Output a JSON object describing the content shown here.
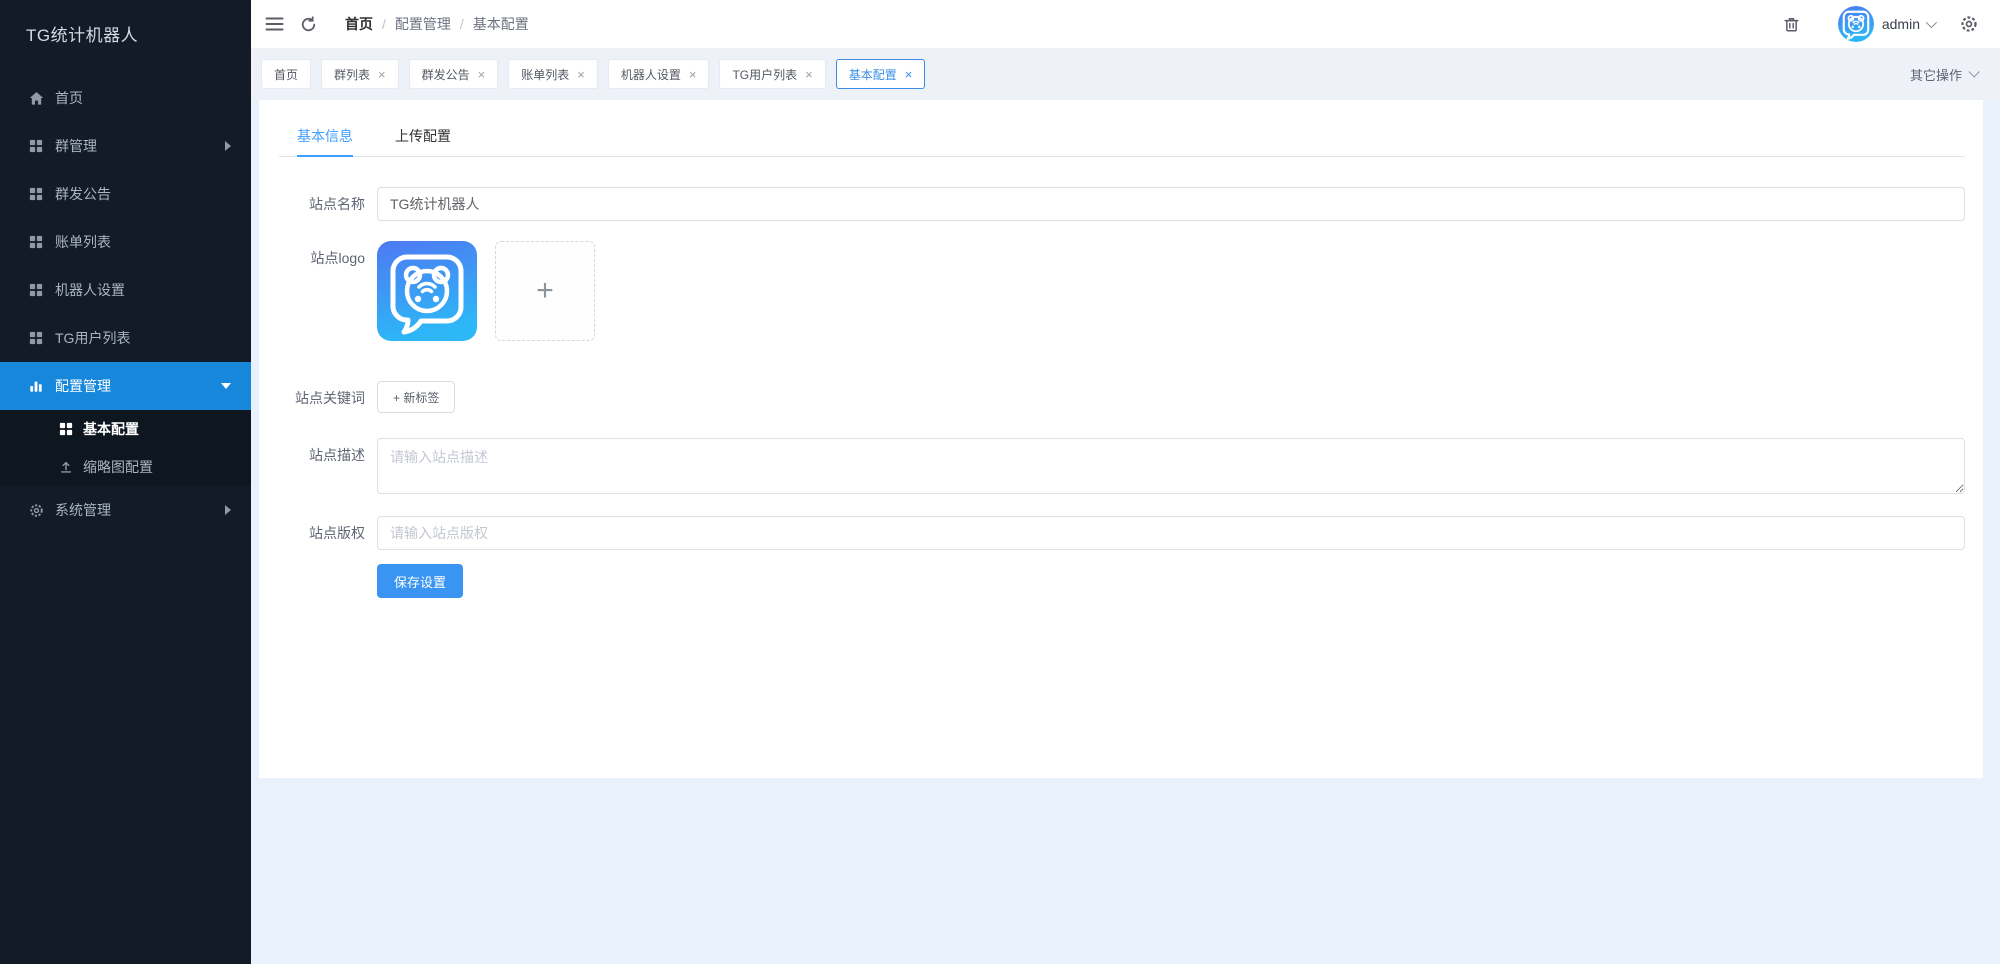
{
  "sidebar": {
    "title": "TG统计机器人",
    "items": [
      {
        "label": "首页"
      },
      {
        "label": "群管理"
      },
      {
        "label": "群发公告"
      },
      {
        "label": "账单列表"
      },
      {
        "label": "机器人设置"
      },
      {
        "label": "TG用户列表"
      },
      {
        "label": "配置管理"
      },
      {
        "label": "基本配置"
      },
      {
        "label": "缩略图配置"
      },
      {
        "label": "系统管理"
      }
    ]
  },
  "header": {
    "breadcrumb": [
      "首页",
      "配置管理",
      "基本配置"
    ],
    "separator": "/",
    "user": "admin"
  },
  "tabs_bar": {
    "tabs": [
      {
        "label": "首页",
        "closable": false
      },
      {
        "label": "群列表",
        "closable": true
      },
      {
        "label": "群发公告",
        "closable": true
      },
      {
        "label": "账单列表",
        "closable": true
      },
      {
        "label": "机器人设置",
        "closable": true
      },
      {
        "label": "TG用户列表",
        "closable": true
      },
      {
        "label": "基本配置",
        "closable": true,
        "active": true
      }
    ],
    "more_label": "其它操作"
  },
  "content": {
    "tabs": [
      {
        "label": "基本信息",
        "active": true
      },
      {
        "label": "上传配置"
      }
    ],
    "form": {
      "site_name": {
        "label": "站点名称",
        "value": "TG统计机器人"
      },
      "site_logo": {
        "label": "站点logo"
      },
      "site_keywords": {
        "label": "站点关键词",
        "add_label": "+ 新标签"
      },
      "site_desc": {
        "label": "站点描述",
        "placeholder": "请输入站点描述"
      },
      "site_copyright": {
        "label": "站点版权",
        "placeholder": "请输入站点版权"
      },
      "save_label": "保存设置"
    }
  },
  "icons": {
    "close": "×",
    "plus": "+"
  },
  "colors": {
    "accent": "#409eff",
    "sidebar_bg": "#121b27",
    "sidebar_active_bg": "#1787dc",
    "save_button": "#3a94f1",
    "page_bg": "#e9f1fa"
  }
}
